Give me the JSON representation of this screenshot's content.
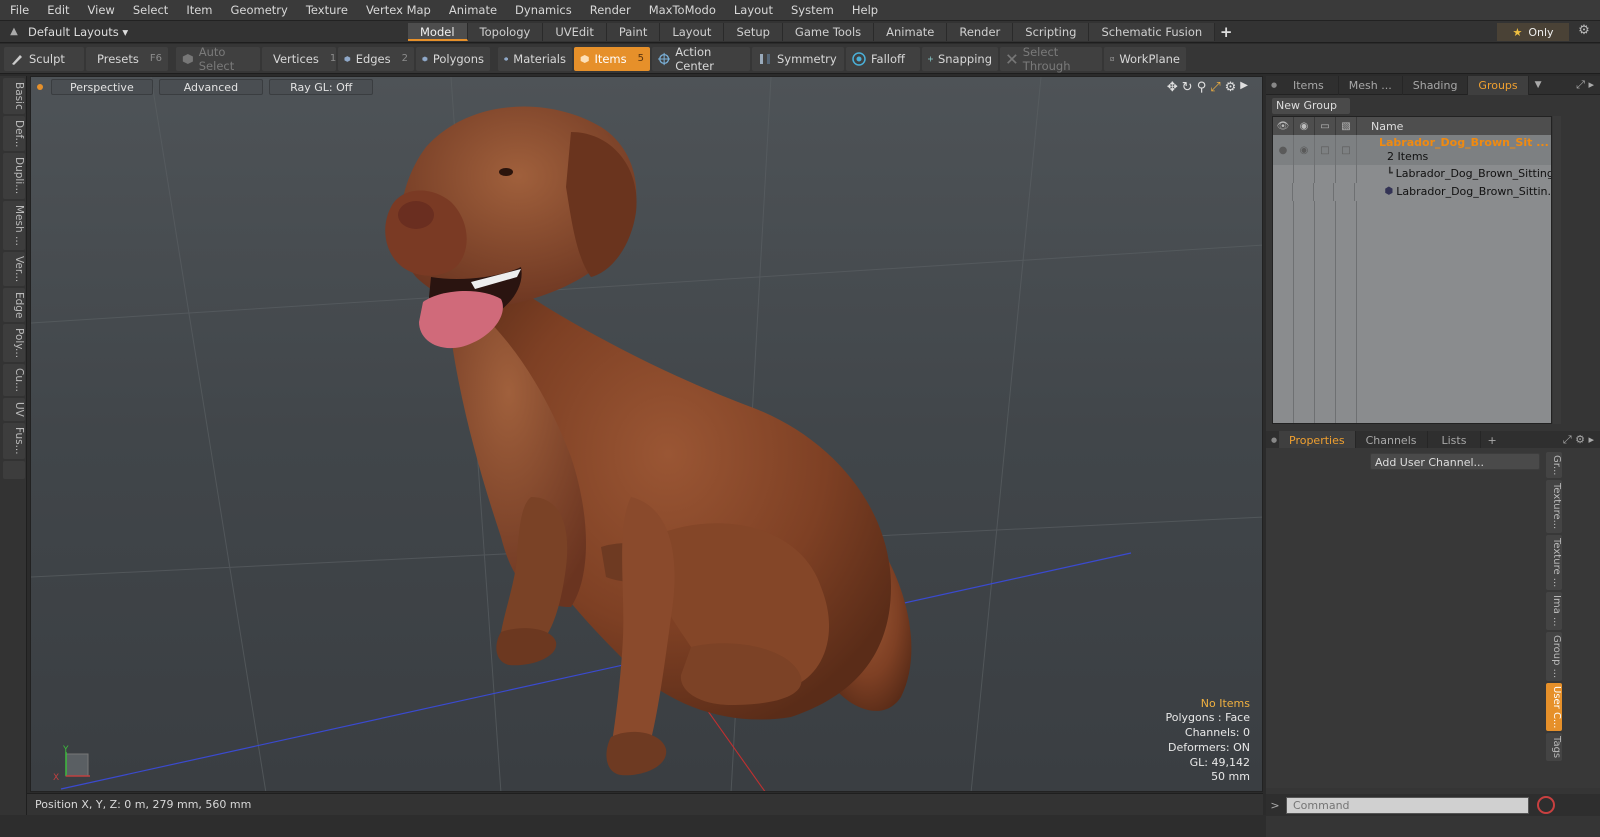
{
  "menu": [
    "File",
    "Edit",
    "View",
    "Select",
    "Item",
    "Geometry",
    "Texture",
    "Vertex Map",
    "Animate",
    "Dynamics",
    "Render",
    "MaxToModo",
    "Layout",
    "System",
    "Help"
  ],
  "layoutbar": {
    "layouts_label": "Default Layouts ▾",
    "tabs": [
      "Model",
      "Topology",
      "UVEdit",
      "Paint",
      "Layout",
      "Setup",
      "Game Tools",
      "Animate",
      "Render",
      "Scripting",
      "Schematic Fusion"
    ],
    "active_tab": "Model",
    "plus": "+",
    "only_label": "Only",
    "star": "★",
    "gear": "⚙"
  },
  "toolbar": {
    "sculpt": "Sculpt",
    "presets": "Presets",
    "presets_key": "F6",
    "auto_select": "Auto Select",
    "vertices": "Vertices",
    "vertices_key": "1",
    "edges": "Edges",
    "edges_key": "2",
    "polygons": "Polygons",
    "materials": "Materials",
    "items": "Items",
    "items_key": "5",
    "action_center": "Action Center",
    "symmetry": "Symmetry",
    "falloff": "Falloff",
    "snapping": "Snapping",
    "select_through": "Select Through",
    "workplane": "WorkPlane"
  },
  "left_tabs": [
    "Basic",
    "Def...",
    "Dupli...",
    "Mesh ...",
    "Ver...",
    "Edge",
    "Poly...",
    "Cu...",
    "UV",
    "Fus..."
  ],
  "viewport": {
    "perspective": "Perspective",
    "advanced": "Advanced",
    "raygl": "Ray GL: Off",
    "info": {
      "items": "No Items",
      "polygons": "Polygons : Face",
      "channels": "Channels: 0",
      "deformers": "Deformers: ON",
      "gl": "GL: 49,142",
      "focal": "50 mm"
    },
    "icons": [
      "move-icon",
      "rotate-icon",
      "zoom-icon",
      "fit-icon",
      "settings-icon",
      "more-icon"
    ],
    "axis_y": "Y",
    "axis_x": "X"
  },
  "status": {
    "position": "Position X, Y, Z:  0 m, 279 mm, 560 mm"
  },
  "right_panel": {
    "top_tabs": [
      "Items",
      "Mesh ...",
      "Shading",
      "Groups"
    ],
    "top_active": "Groups",
    "new_group": "New Group",
    "list_header": "Name",
    "group_name": "Labrador_Dog_Brown_Sit ...",
    "group_count": "2 Items",
    "child1": "Labrador_Dog_Brown_Sitting",
    "child2": "Labrador_Dog_Brown_Sittin...",
    "bottom_tabs": [
      "Properties",
      "Channels",
      "Lists"
    ],
    "bottom_active": "Properties",
    "add_channel": "Add User Channel...",
    "side_tabs": [
      "Gr...",
      "Texture...",
      "Texture ...",
      "Ima ...",
      "Group ...",
      "User C...",
      "Tags"
    ],
    "side_active": "User C...",
    "command_placeholder": "Command"
  },
  "colors": {
    "accent": "#e6902a",
    "viewport": "#454a4e",
    "dog": "#8a4a2c"
  }
}
